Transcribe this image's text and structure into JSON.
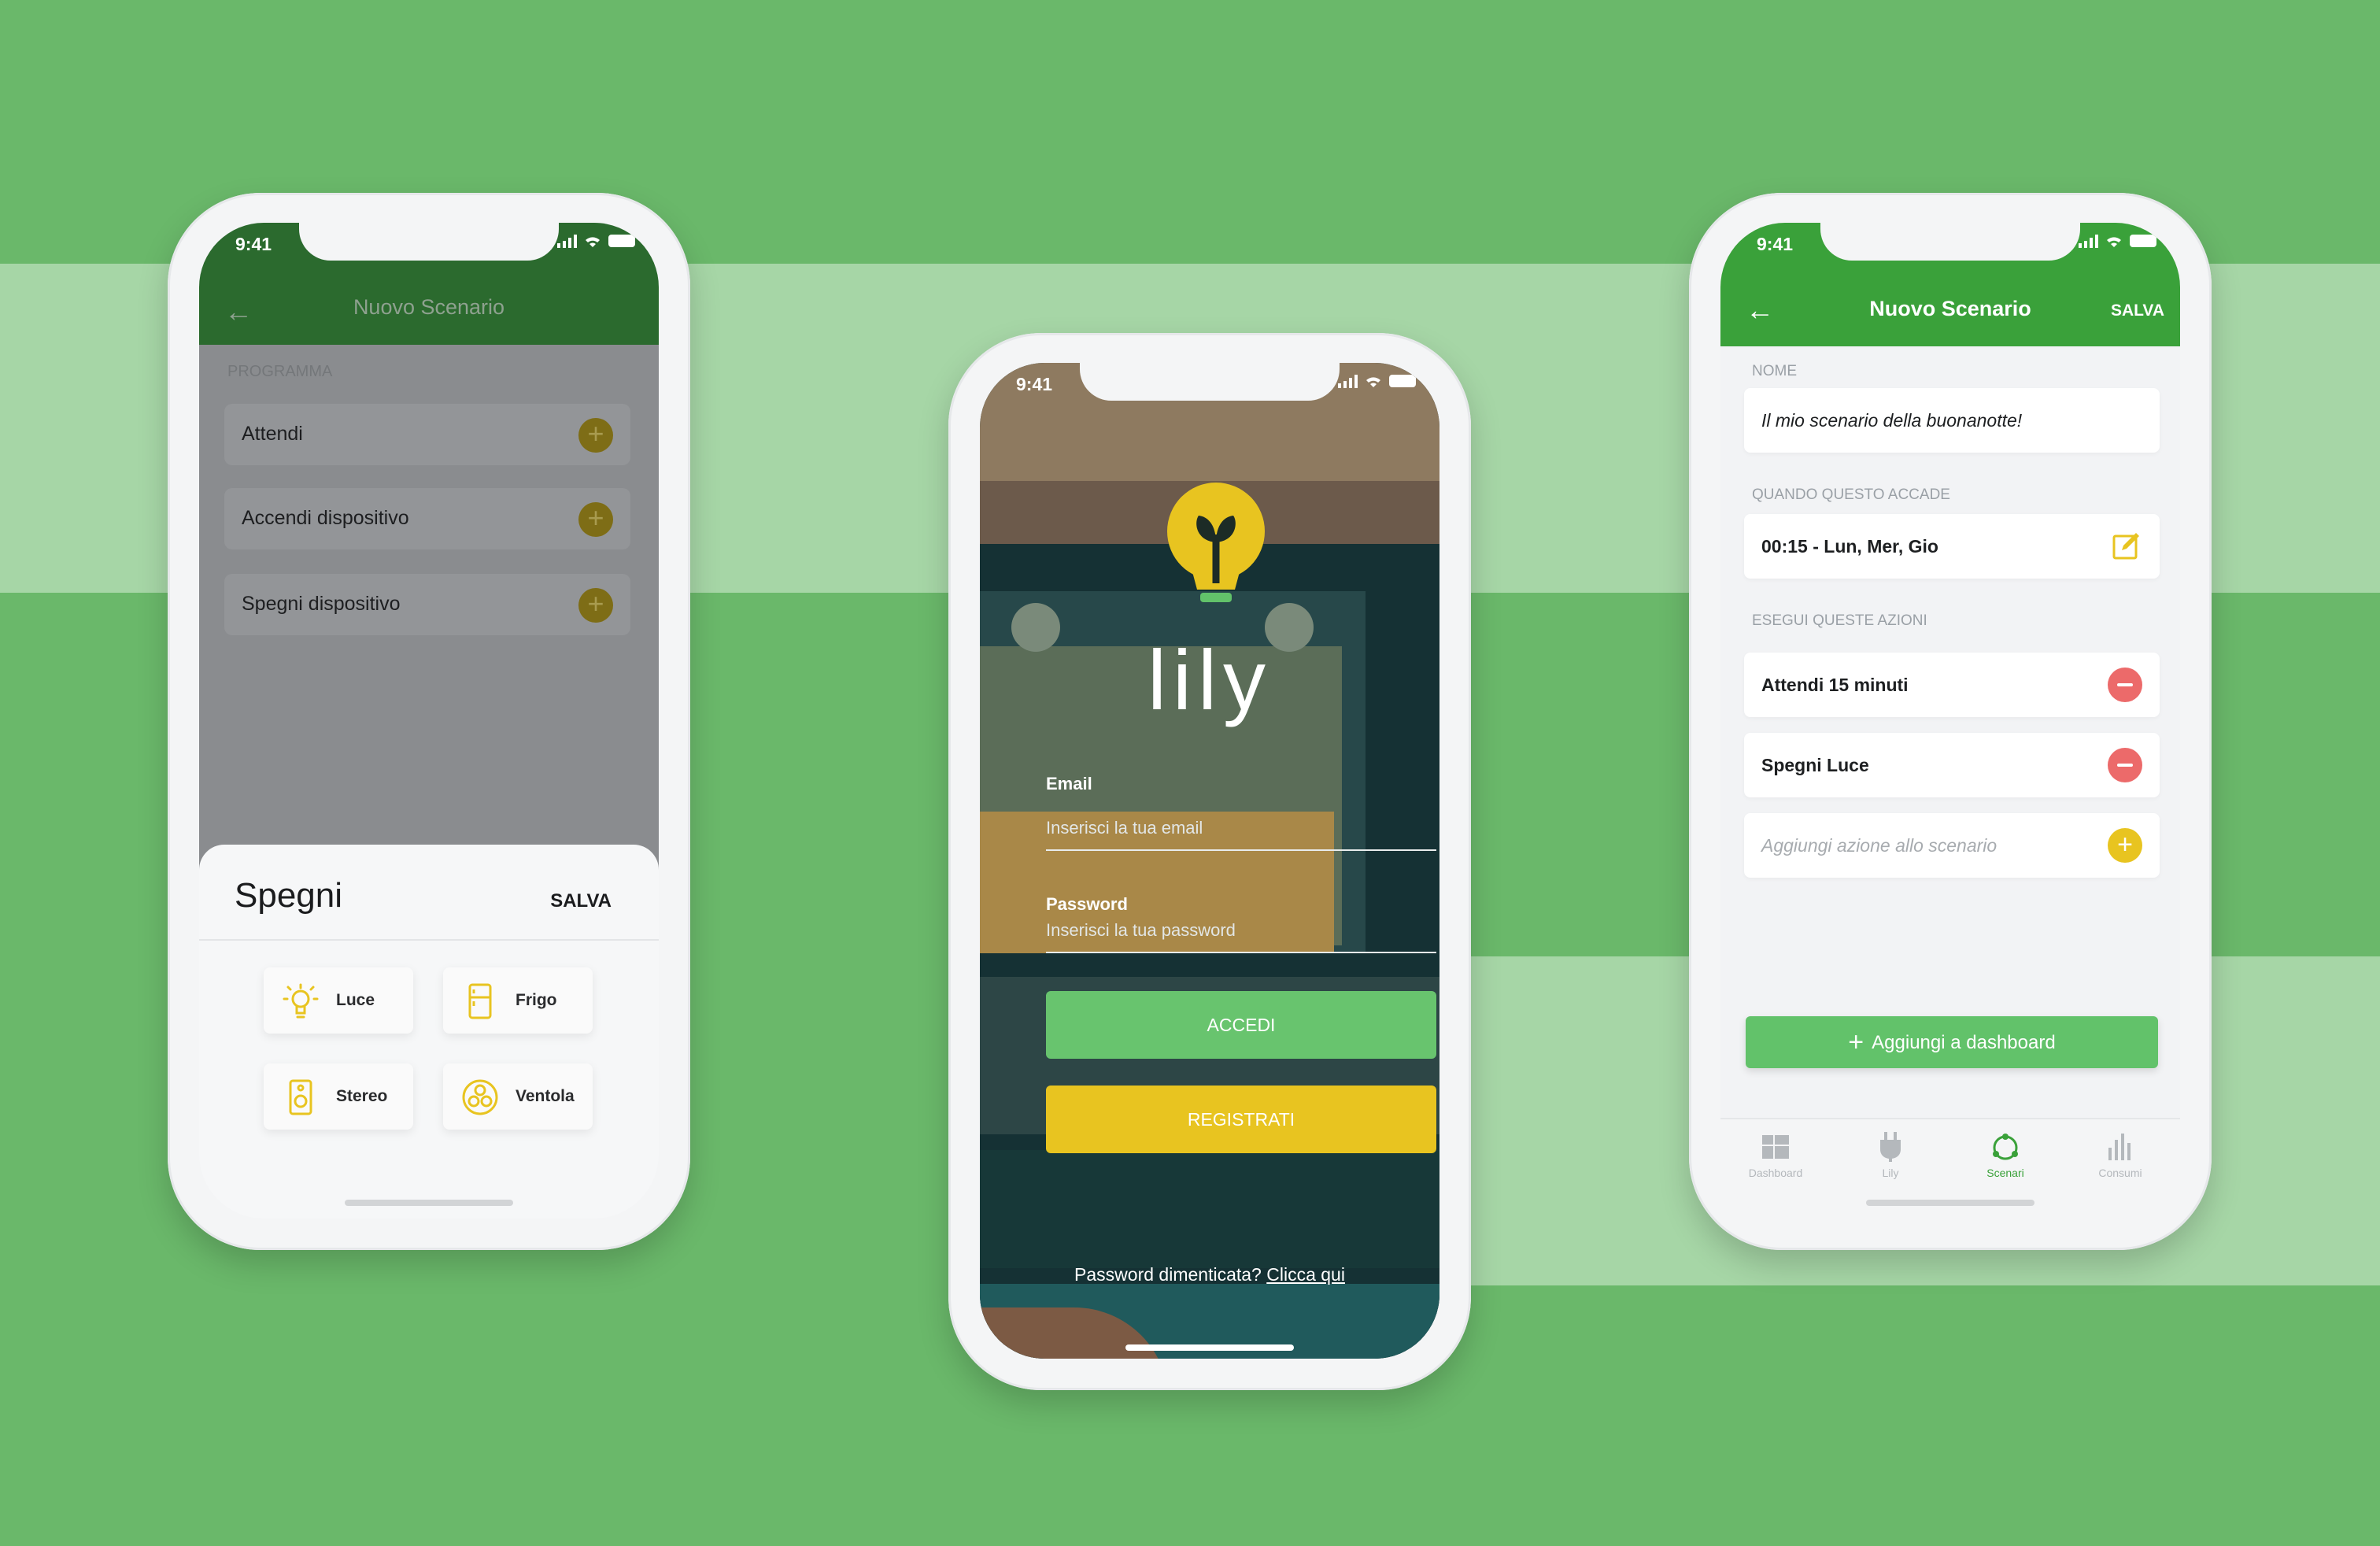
{
  "colors": {
    "background": "#6ab86a",
    "band": "#a6d6a6",
    "appbar_dark": "#2b6a2e",
    "appbar": "#3aa13a",
    "button_green": "#62c26a",
    "button_yellow": "#e8c420",
    "remove_red": "#ec6a6a"
  },
  "phone1": {
    "status_time": "9:41",
    "back_icon": "arrow-left-icon",
    "title": "Nuovo Scenario",
    "section": "PROGRAMMA",
    "rows": [
      {
        "label": "Attendi"
      },
      {
        "label": "Accendi dispositivo"
      },
      {
        "label": "Spegni dispositivo"
      }
    ],
    "sheet": {
      "title": "Spegni",
      "save": "SALVA",
      "devices": [
        {
          "label": "Luce",
          "icon": "lightbulb-icon"
        },
        {
          "label": "Frigo",
          "icon": "fridge-icon"
        },
        {
          "label": "Stereo",
          "icon": "speaker-icon"
        },
        {
          "label": "Ventola",
          "icon": "fan-icon"
        }
      ]
    }
  },
  "phone2": {
    "status_time": "9:41",
    "logo": "lily",
    "email_label": "Email",
    "email_placeholder": "Inserisci la tua email",
    "password_label": "Password",
    "password_placeholder": "Inserisci la tua password",
    "login_button": "ACCEDI",
    "register_button": "REGISTRATI",
    "forgot_text": "Password dimenticata?",
    "forgot_link": "Clicca qui"
  },
  "phone3": {
    "status_time": "9:41",
    "title": "Nuovo Scenario",
    "save": "SALVA",
    "name_section": "NOME",
    "name_value": "Il mio scenario della buonanotte!",
    "when_section": "QUANDO QUESTO ACCADE",
    "when_value": "00:15 - Lun, Mer, Gio",
    "actions_section": "ESEGUI QUESTE AZIONI",
    "actions": [
      {
        "label": "Attendi 15 minuti"
      },
      {
        "label": "Spegni Luce"
      }
    ],
    "add_action_placeholder": "Aggiungi azione allo scenario",
    "dashboard_button": "Aggiungi a dashboard",
    "tabs": [
      {
        "label": "Dashboard",
        "icon": "dashboard-icon"
      },
      {
        "label": "Lily",
        "icon": "plug-icon"
      },
      {
        "label": "Scenari",
        "icon": "scenes-icon",
        "active": true
      },
      {
        "label": "Consumi",
        "icon": "bar-chart-icon"
      }
    ]
  }
}
